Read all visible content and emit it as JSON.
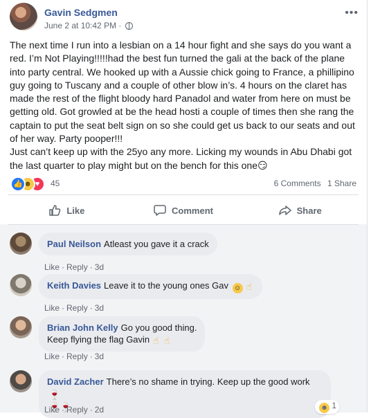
{
  "post": {
    "author": "Gavin Sedgmen",
    "date": "June 2 at 10:42 PM",
    "date_sep": "·",
    "more_icon": "more-dots-icon",
    "text": "The next time I run into a lesbian on a 14 hour fight and she says do you want a red. I’m Not Playing!!!!!had the best fun turned the gali at the back of the plane into party central. We hooked up with a Aussie chick going to France, a phillipino guy going to Tuscany and a couple of other blow in’s. 4 hours on the claret has made the rest of the flight bloody hard Panadol and water from here on must be getting old. Got growled at be the head hosti a couple of times then she rang the captain to put the seat belt sign on so she could get us back to our seats and out of her way. Party pooper!!!\nJust can’t keep up with the 25yo any more. Licking my wounds in Abu Dhabi got the last quarter to play might but on the bench for this one",
    "text_emoji": "😏"
  },
  "stats": {
    "reaction_count": "45",
    "reactions": [
      "like",
      "haha",
      "love"
    ],
    "comments": "6 Comments",
    "shares": "1 Share"
  },
  "actions": {
    "like": "Like",
    "comment": "Comment",
    "share": "Share"
  },
  "comments": [
    {
      "name": "Paul Neilson",
      "text": "Atleast you gave it a crack",
      "like": "Like",
      "reply": "Reply",
      "time": "3d"
    },
    {
      "name": "Keith Davies",
      "text": "Leave it to the young ones Gav",
      "like": "Like",
      "reply": "Reply",
      "time": "3d"
    },
    {
      "name": "Brian John Kelly",
      "text": "Go you good thing.",
      "text2": "Keep flying the flag Gavin",
      "like": "Like",
      "reply": "Reply",
      "time": "3d"
    },
    {
      "name": "David Zacher",
      "text": "There’s no shame in trying. Keep up the good work",
      "like": "Like",
      "reply": "Reply",
      "time": "2d",
      "reaction_count": "1"
    }
  ],
  "colors": {
    "link": "#385898",
    "like_blue": "#2078f4",
    "love_red": "#f2385a",
    "haha_yellow": "#f7c94a"
  }
}
